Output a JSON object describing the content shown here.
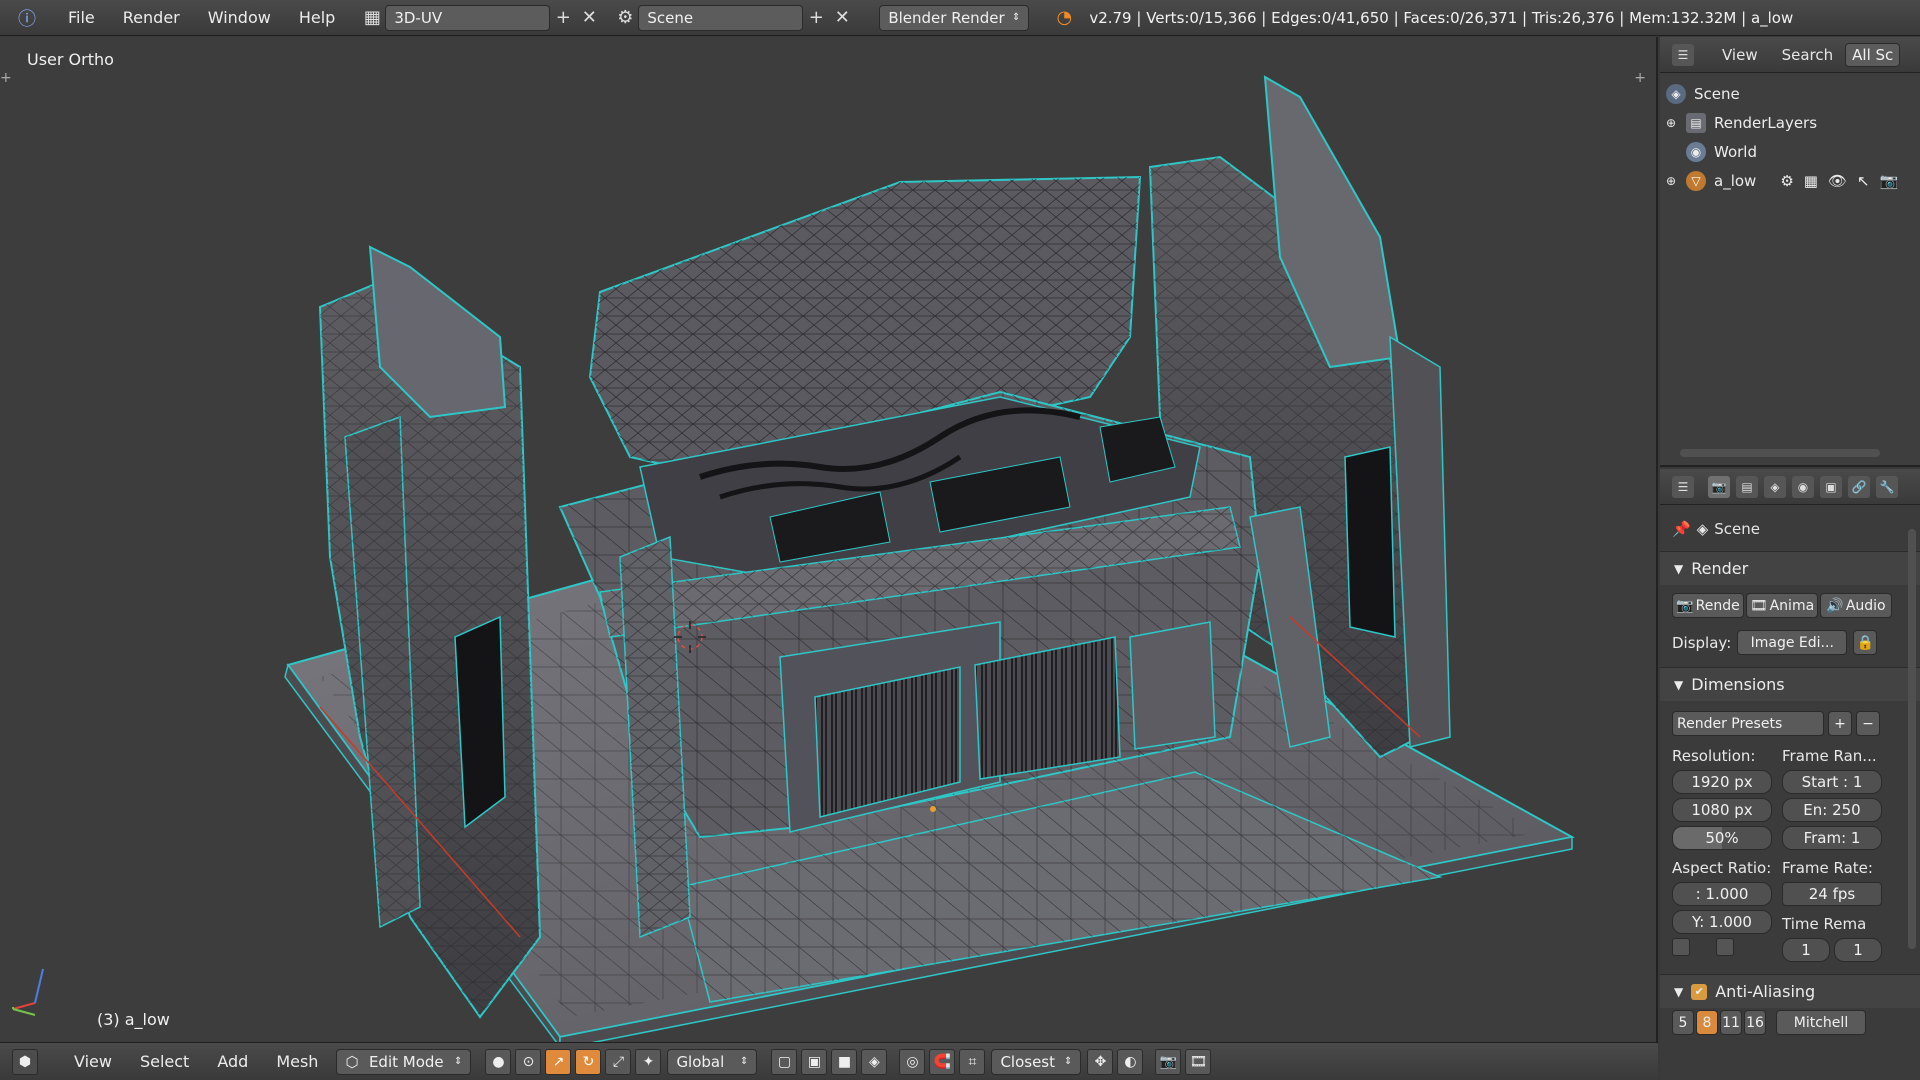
{
  "topbar": {
    "menus": [
      "File",
      "Render",
      "Window",
      "Help"
    ],
    "screen_layout": "3D-UV",
    "scene": "Scene",
    "engine": "Blender Render",
    "stats": "v2.79 | Verts:0/15,366 | Edges:0/41,650 | Faces:0/26,371 | Tris:26,376 | Mem:132.32M | a_low"
  },
  "viewport": {
    "view_name": "User Ortho",
    "object_label": "(3) a_low",
    "colors": {
      "background": "#3d3d3d",
      "wire": "#2fc6c6",
      "mesh": "#6e6e72"
    }
  },
  "bottombar": {
    "menus": [
      "View",
      "Select",
      "Add",
      "Mesh"
    ],
    "mode": "Edit Mode",
    "orientation": "Global",
    "snap": "Closest"
  },
  "outliner": {
    "header": [
      "View",
      "Search",
      "All Sc"
    ],
    "items": [
      {
        "label": "Scene",
        "icon": "scene-icon"
      },
      {
        "label": "RenderLayers",
        "icon": "render-layers-icon"
      },
      {
        "label": "World",
        "icon": "world-icon"
      },
      {
        "label": "a_low",
        "icon": "mesh-object-icon"
      }
    ]
  },
  "properties": {
    "context": "Scene",
    "render_panel": {
      "title": "Render",
      "buttons": [
        "Rende",
        "Anima",
        "Audio"
      ],
      "display_label": "Display:",
      "display_value": "Image Edi..."
    },
    "dimensions_panel": {
      "title": "Dimensions",
      "presets": "Render Presets",
      "resolution_label": "Resolution:",
      "res_x": "1920 px",
      "res_y": "1080 px",
      "res_pct": "50%",
      "frame_range_label": "Frame Ran...",
      "start": "Start : 1",
      "end": "En: 250",
      "frame": "Fram: 1",
      "aspect_label": "Aspect Ratio:",
      "aspect_x": ": 1.000",
      "aspect_y": "Y: 1.000",
      "frame_rate_label": "Frame Rate:",
      "fps": "24 fps",
      "time_remap_label": "Time Rema",
      "remap_old": "1",
      "remap_new": "1"
    },
    "aa_panel": {
      "title": "Anti-Aliasing",
      "samples": [
        "5",
        "8",
        "11",
        "16"
      ],
      "filter": "Mitchell"
    }
  }
}
